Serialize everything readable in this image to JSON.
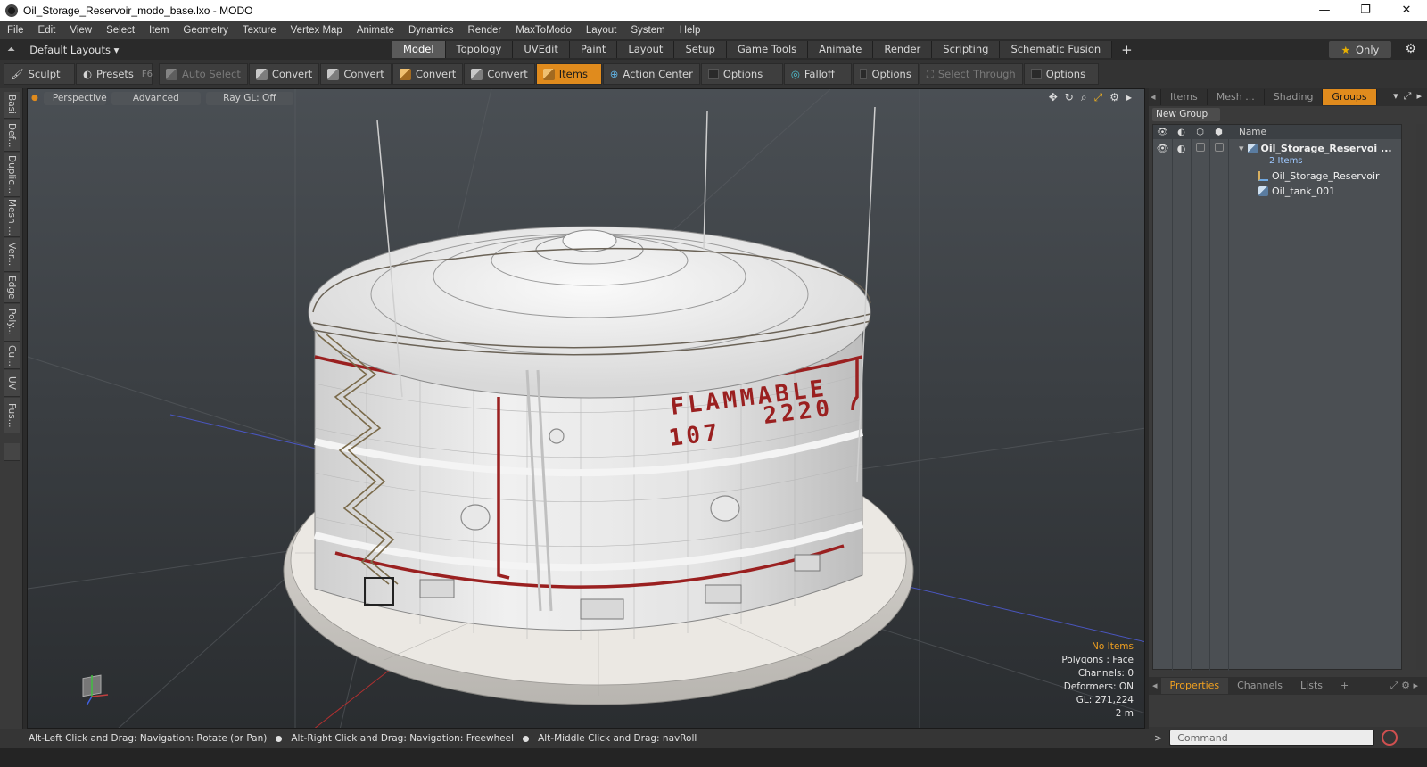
{
  "window": {
    "title": "Oil_Storage_Reservoir_modo_base.lxo - MODO",
    "controls": [
      "—",
      "❐",
      "✕"
    ]
  },
  "menu": [
    "File",
    "Edit",
    "View",
    "Select",
    "Item",
    "Geometry",
    "Texture",
    "Vertex Map",
    "Animate",
    "Dynamics",
    "Render",
    "MaxToModo",
    "Layout",
    "System",
    "Help"
  ],
  "layout_tabs": {
    "layouts_label": "Default Layouts ▾",
    "tabs": [
      "Model",
      "Topology",
      "UVEdit",
      "Paint",
      "Layout",
      "Setup",
      "Game Tools",
      "Animate",
      "Render",
      "Scripting",
      "Schematic Fusion"
    ],
    "active": "Model",
    "plus": "+",
    "only_label": "Only"
  },
  "toolbar": {
    "sculpt": "Sculpt",
    "presets": "Presets",
    "presets_key": "F6",
    "auto_select": "Auto Select",
    "convert1": "Convert",
    "convert2": "Convert",
    "convert3": "Convert",
    "convert4": "Convert",
    "items": "Items",
    "action_center": "Action Center",
    "options1": "Options",
    "falloff": "Falloff",
    "options2": "Options",
    "select_through": "Select Through",
    "options3": "Options"
  },
  "left_tabs": [
    "Basi",
    "Def...",
    "Duplic...",
    "Mesh ...",
    "Ver...",
    "Edge",
    "Poly...",
    "Cu...",
    "UV",
    "Fus..."
  ],
  "viewport": {
    "perspective": "Perspective",
    "advanced": "Advanced",
    "raygl": "Ray GL: Off",
    "sign_line1": "FLAMMABLE",
    "sign_line2_left": "107",
    "sign_line2_right": "2220",
    "info": {
      "selection": "No Items",
      "polygons": "Polygons : Face",
      "channels": "Channels: 0",
      "deformers": "Deformers: ON",
      "gl": "GL: 271,224",
      "scale": "2 m"
    }
  },
  "status": {
    "hint1": "Alt-Left Click and Drag: Navigation: Rotate (or Pan)",
    "hint2": "Alt-Right Click and Drag: Navigation: Freewheel",
    "hint3": "Alt-Middle Click and Drag: navRoll"
  },
  "right_panel": {
    "tabs": [
      "Items",
      "Mesh ...",
      "Shading",
      "Groups"
    ],
    "active_tab": "Groups",
    "new_group": "New Group",
    "name_header": "Name",
    "rows": [
      {
        "label": "Oil_Storage_Reservoi ...",
        "sub": "2 Items"
      },
      {
        "label": "Oil_Storage_Reservoir"
      },
      {
        "label": "Oil_tank_001"
      }
    ],
    "bottom_tabs": [
      "Properties",
      "Channels",
      "Lists"
    ],
    "bottom_active": "Properties",
    "command_placeholder": "Command"
  },
  "colors": {
    "accent_orange": "#e08b1d",
    "sign_red": "#9a2020"
  }
}
